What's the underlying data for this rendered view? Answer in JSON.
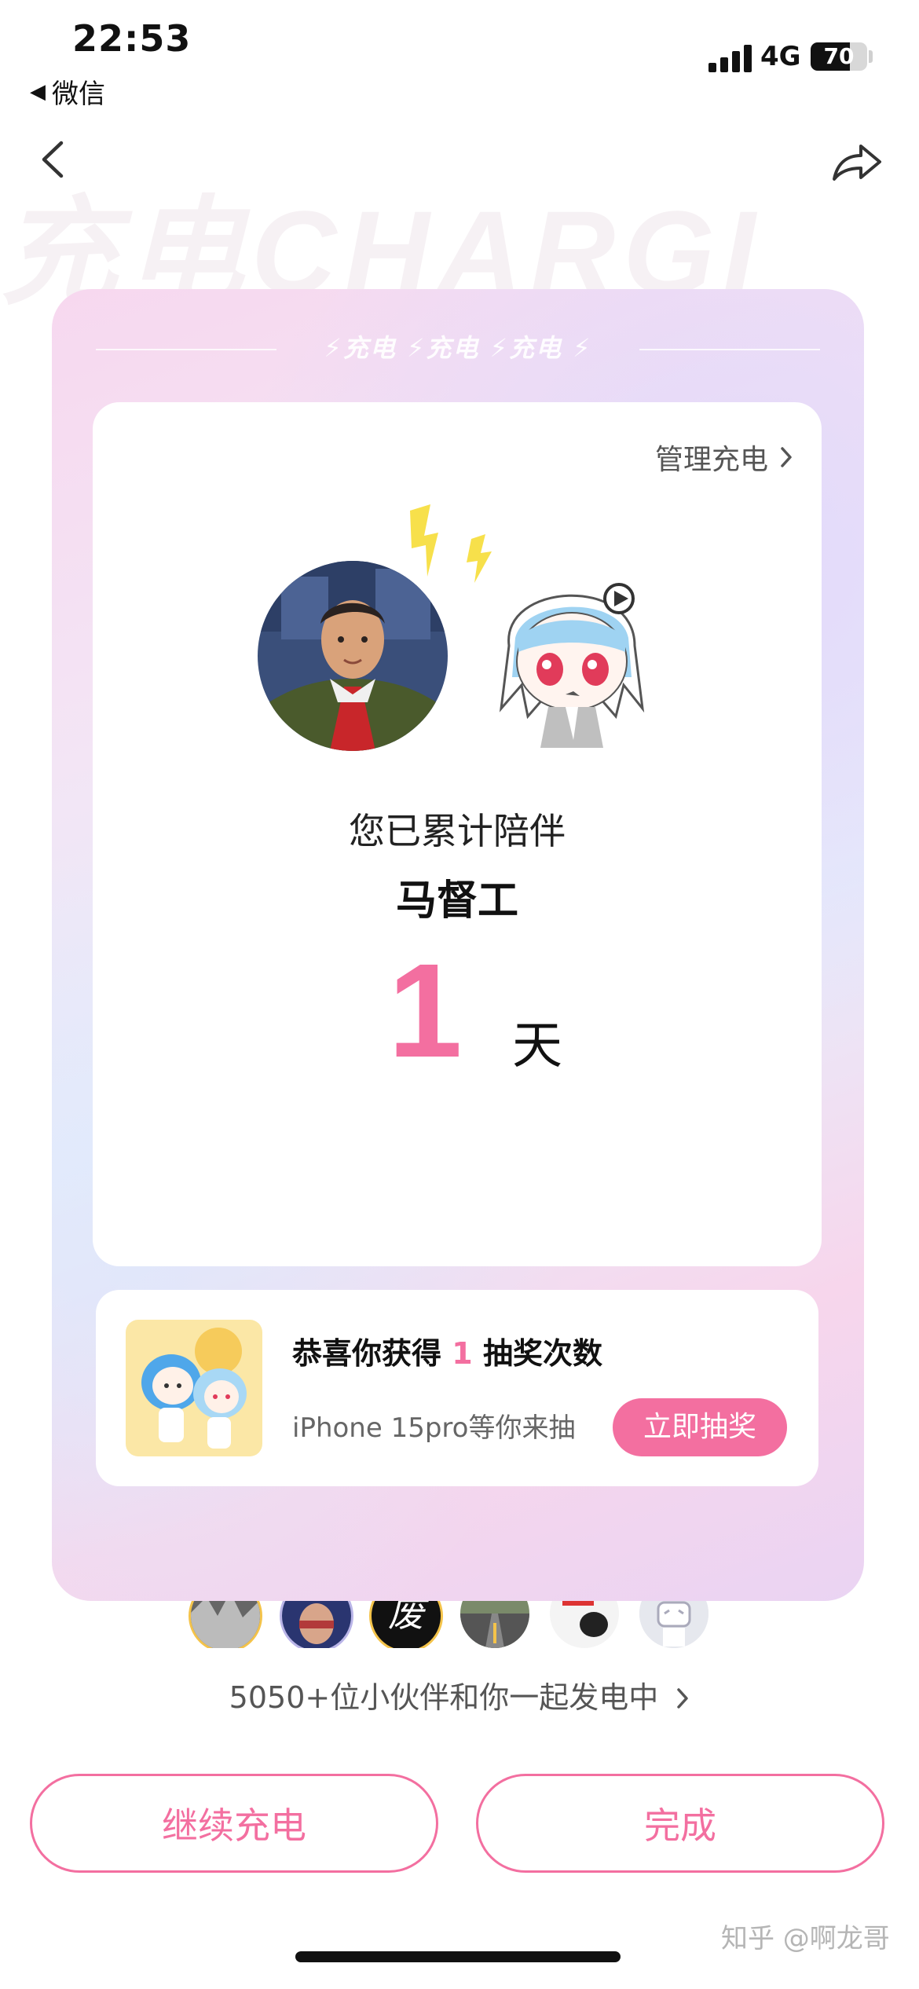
{
  "status_bar": {
    "time": "22:53",
    "back_app": "微信",
    "network": "4G",
    "battery": "70",
    "battery_level_percent": 70
  },
  "nav": {
    "back_icon": "chevron-left-icon",
    "share_icon": "share-icon",
    "bg_watermark": "充电CHARGI"
  },
  "card": {
    "banner": "⚡充电 ⚡充电 ⚡充电 ⚡",
    "manage_label": "管理充电",
    "caption": "您已累计陪伴",
    "creator_name": "马督工",
    "days": "1",
    "days_unit": "天"
  },
  "lottery": {
    "title_prefix": "恭喜你获得",
    "count": "1",
    "title_suffix": "抽奖次数",
    "subtitle": "iPhone 15pro等你来抽",
    "button": "立即抽奖"
  },
  "supporters": {
    "avatar_text": "废",
    "helpers_text": "5050+位小伙伴和你一起发电中"
  },
  "actions": {
    "continue": "继续充电",
    "done": "完成"
  },
  "watermark": "知乎 @啊龙哥",
  "colors": {
    "accent": "#f36fa0",
    "bolt": "#f7e04b"
  }
}
